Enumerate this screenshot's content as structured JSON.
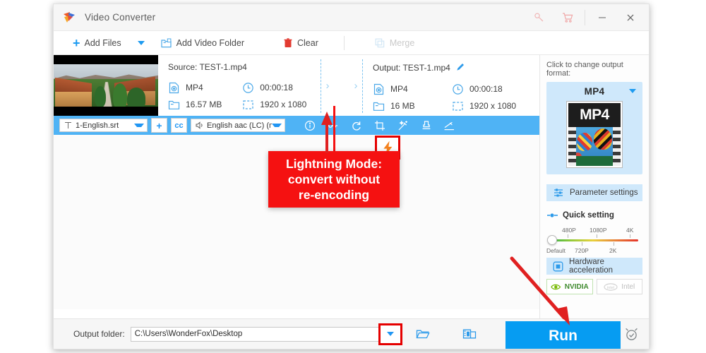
{
  "window": {
    "title": "Video Converter",
    "logo_icon": "play-triangle-logo",
    "titlebar_buttons": [
      {
        "name": "key-icon",
        "glyph": "key"
      },
      {
        "name": "cart-icon",
        "glyph": "cart"
      },
      {
        "name": "minimize-icon",
        "glyph": "minimize"
      },
      {
        "name": "close-icon",
        "glyph": "close"
      }
    ]
  },
  "toolbar": {
    "add_files": "Add Files",
    "add_files_caret": "chevron-down-icon",
    "add_video_folder": "Add Video Folder",
    "clear": "Clear",
    "merge": "Merge",
    "merge_disabled": true
  },
  "file_row": {
    "source_title": "Source: TEST-1.mp4",
    "source": {
      "format": "MP4",
      "duration": "00:00:18",
      "size": "16.57 MB",
      "resolution": "1920 x 1080"
    },
    "output_title": "Output: TEST-1.mp4",
    "output": {
      "format": "MP4",
      "duration": "00:00:18",
      "size": "16 MB",
      "resolution": "1920 x 1080"
    },
    "lightning_icon": "lightning-bolt-icon",
    "edit_icon": "pencil-icon",
    "remove_icon": "close-icon"
  },
  "blue_strip": {
    "subtitle_value": "1-English.srt",
    "add_subtitle_label": "+",
    "closed_caption_label": "cc",
    "audio_value": "English aac (LC) (m",
    "icons": [
      "info-icon",
      "key-icon",
      "rotate-icon",
      "crop-icon",
      "effects-icon",
      "watermark-icon",
      "trim-icon"
    ]
  },
  "right_panel": {
    "prompt": "Click to change output format:",
    "format_name": "MP4",
    "format_thumb_text": "MP4",
    "parameter_settings": "Parameter settings",
    "quick_setting": "Quick setting",
    "slider": {
      "top_labels": [
        "480P",
        "1080P",
        "4K"
      ],
      "bottom_labels": [
        "Default",
        "720P",
        "2K"
      ],
      "value": "Default"
    },
    "hardware_acceleration": "Hardware acceleration",
    "gpu_nvidia": "NVIDIA",
    "gpu_intel": "Intel",
    "gpu_nvidia_enabled": true,
    "gpu_intel_enabled": false
  },
  "bottom_bar": {
    "output_folder_label": "Output folder:",
    "output_folder_path": "C:\\Users\\WonderFox\\Desktop",
    "dropdown_icon": "chevron-down-icon",
    "open_folder_icon": "folder-icon",
    "media_folder_icon": "media-folder-icon",
    "run_label": "Run",
    "alarm_icon": "alarm-clock-icon"
  },
  "annotations": {
    "callout_line1": "Lightning Mode:",
    "callout_line2": "convert without",
    "callout_line3": "re-encoding",
    "callout_color": "#f51111",
    "highlight_border_color": "#e50000",
    "arrow_color": "#e02020"
  },
  "colors": {
    "accent_blue": "#1e9bf0",
    "strip_blue": "#4fb3f5",
    "run_blue": "#069cf2",
    "panel_blue": "#cfe8fb"
  }
}
